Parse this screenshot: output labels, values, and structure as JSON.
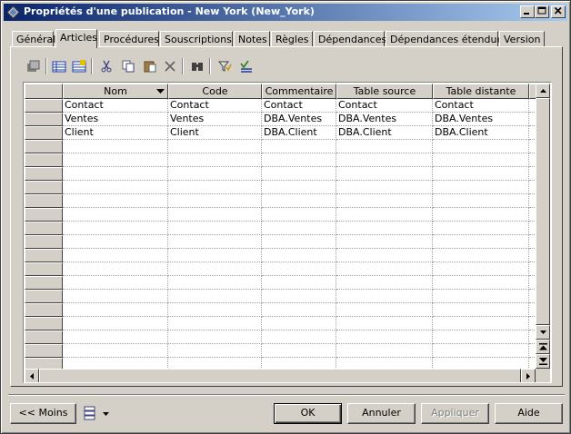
{
  "window": {
    "title": "Propriétés d'une publication - New York (New_York)"
  },
  "tabs": [
    {
      "label": "Général"
    },
    {
      "label": "Articles",
      "active": true
    },
    {
      "label": "Procédures"
    },
    {
      "label": "Souscriptions"
    },
    {
      "label": "Notes"
    },
    {
      "label": "Règles"
    },
    {
      "label": "Dépendances"
    },
    {
      "label": "Dépendances étendues"
    },
    {
      "label": "Version"
    }
  ],
  "toolbar": {
    "icons": [
      "properties-icon",
      "add-row-icon",
      "insert-row-icon",
      "cut-icon",
      "copy-icon",
      "paste-icon",
      "delete-icon",
      "find-icon",
      "filter-icon",
      "customize-columns-icon"
    ]
  },
  "grid": {
    "columns": [
      "Nom",
      "Code",
      "Commentaire",
      "Table source",
      "Table distante"
    ],
    "rows": [
      [
        "Contact",
        "Contact",
        "Contact",
        "Contact",
        "Contact"
      ],
      [
        "Ventes",
        "Ventes",
        "DBA.Ventes",
        "DBA.Ventes",
        "DBA.Ventes"
      ],
      [
        "Client",
        "Client",
        "DBA.Client",
        "DBA.Client",
        "DBA.Client"
      ]
    ],
    "empty_rows": 17
  },
  "buttons": {
    "less": "<< Moins",
    "ok": "OK",
    "cancel": "Annuler",
    "apply": "Appliquer",
    "help": "Aide"
  }
}
